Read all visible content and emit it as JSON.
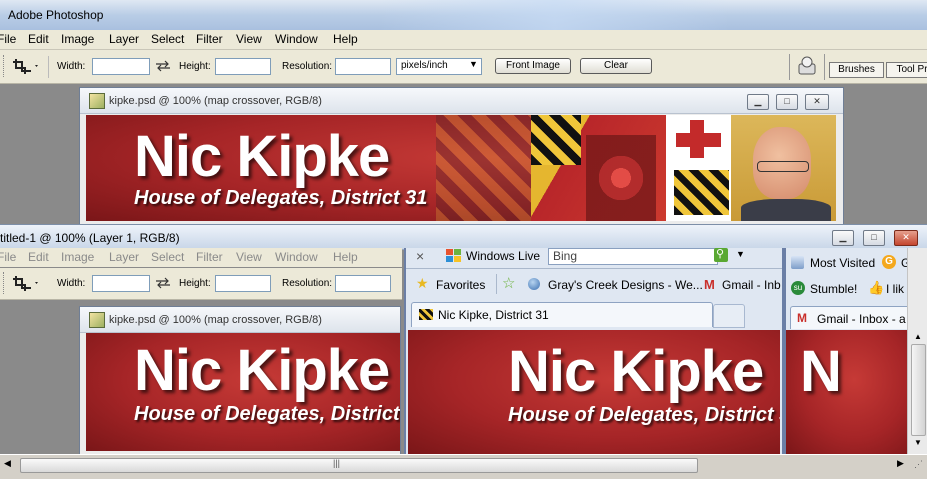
{
  "app": {
    "title": "Adobe Photoshop"
  },
  "menu": [
    "File",
    "Edit",
    "Image",
    "Layer",
    "Select",
    "Filter",
    "View",
    "Window",
    "Help"
  ],
  "options": {
    "width_label": "Width:",
    "height_label": "Height:",
    "resolution_label": "Resolution:",
    "units": "pixels/inch",
    "front_image": "Front Image",
    "clear": "Clear",
    "tabs": [
      "Brushes",
      "Tool Pr"
    ]
  },
  "doc1": {
    "title": "kipke.psd @ 100% (map crossover, RGB/8)",
    "name": "Nic Kipke",
    "subtitle": "House of Delegates, District 31"
  },
  "ps2": {
    "title": "titled-1 @ 100% (Layer 1, RGB/8)",
    "options": {
      "width_label": "Width:",
      "height_label": "Height:",
      "resolution_label": "Resolution:"
    }
  },
  "doc2": {
    "title": "kipke.psd @ 100% (map crossover, RGB/8)",
    "name": "Nic Kipke",
    "subtitle": "House of Delegates, District 3"
  },
  "browser": {
    "search_provider": "Windows Live",
    "search_value": "Bing",
    "favorites_label": "Favorites",
    "fav_item1": "Gray's Creek Designs - We...",
    "fav_item2": "Gmail - Inb",
    "tab_title": "Nic Kipke, District 31",
    "page_name": "Nic Kipke",
    "page_subtitle": "House of Delegates, District 3"
  },
  "browser2": {
    "most_visited": "Most Visited",
    "most_visited_tail": "G",
    "stumble": "Stumble!",
    "ilike": "I lik",
    "tab_title": "Gmail - Inbox - a",
    "page_name": "N"
  },
  "colors": {
    "banner_red": "#a62527",
    "accent_blue": "#6b7fa6"
  }
}
